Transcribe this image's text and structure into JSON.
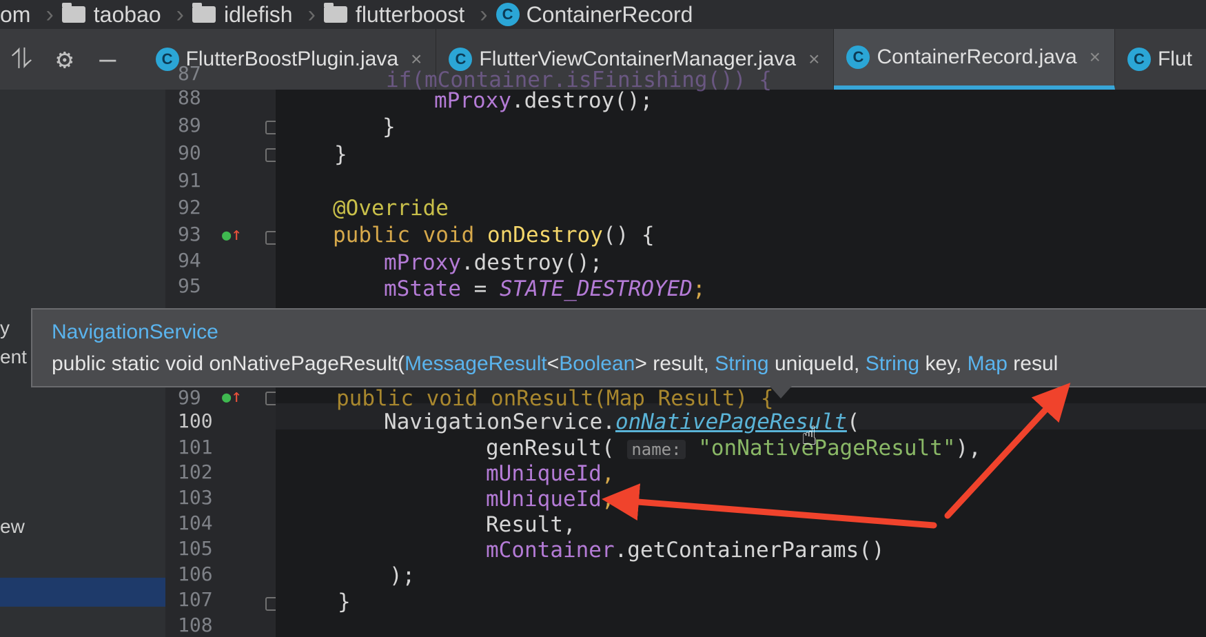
{
  "breadcrumb": {
    "items": [
      "om",
      "taobao",
      "idlefish",
      "flutterboost",
      "ContainerRecord"
    ],
    "class_icon_letter": "C"
  },
  "toolbar": {
    "collapse_icon": "collapse-icon",
    "settings_icon": "gear-icon",
    "hide_icon": "minus-icon"
  },
  "tabs": [
    {
      "label": "FlutterBoostPlugin.java",
      "active": false
    },
    {
      "label": "FlutterViewContainerManager.java",
      "active": false
    },
    {
      "label": "ContainerRecord.java",
      "active": true
    },
    {
      "label": "Flut",
      "active": false
    }
  ],
  "tab_close": "×",
  "left_panel": {
    "fragments": [
      "y",
      "ent",
      "ew"
    ]
  },
  "editor": {
    "line_numbers": [
      "87",
      "88",
      "89",
      "90",
      "91",
      "92",
      "93",
      "94",
      "95",
      "99",
      "100",
      "101",
      "102",
      "103",
      "104",
      "105",
      "106",
      "107",
      "108"
    ],
    "code": {
      "l87": "if(mContainer.isFinishing()) {",
      "l88_obj": "mProxy",
      "l88_rest": ".destroy();",
      "l89": "}",
      "l90": "}",
      "l92": "@Override",
      "l93_kw": "public void ",
      "l93_fn": "onDestroy",
      "l93_rest": "() {",
      "l94_obj": "mProxy",
      "l94_rest": ".destroy();",
      "l95_fld": "mState",
      "l95_eq": " = ",
      "l95_const": "STATE_DESTROYED",
      "l95_end": ";",
      "l99": "public void onResult(Map Result) {",
      "l100_obj": "NavigationService.",
      "l100_method": "onNativePageResult",
      "l100_end": "(",
      "l101_call": "genResult(",
      "l101_hint": "name:",
      "l101_str": "\"onNativePageResult\"",
      "l101_end": "),",
      "l102": "mUniqueId",
      "l103": "mUniqueId",
      "l104": "Result,",
      "l105_obj": "mContainer",
      "l105_rest": ".getContainerParams()",
      "l106": ");",
      "l107": "}",
      "comma": ","
    }
  },
  "tooltip": {
    "title": "NavigationService",
    "sig_start": "public static void onNativePageResult(",
    "t1": "MessageResult",
    "lt": "<",
    "t2": "Boolean",
    "p1": "> result, ",
    "t3": "String",
    "p2": " uniqueId, ",
    "t4": "String",
    "p3": " key, ",
    "t5": "Map",
    "p4": " resul"
  },
  "colors": {
    "accent": "#38a6d8",
    "annotation_arrow": "#f0432c",
    "type_link": "#5ab4ee"
  }
}
